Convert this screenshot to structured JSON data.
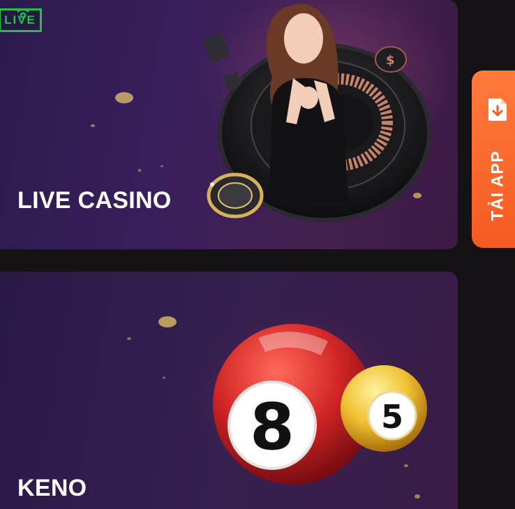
{
  "cards": [
    {
      "id": "live-casino",
      "title": "LIVE CASINO",
      "badge": "LIVE"
    },
    {
      "id": "keno",
      "title": "KENO",
      "ball_numbers": [
        "8",
        "5"
      ]
    }
  ],
  "side_tab": {
    "label": "TẢI APP",
    "icon": "download-icon"
  },
  "colors": {
    "page_bg": "#141214",
    "live_badge": "#22c24a",
    "side_tab": "#f45a21",
    "keno_red_ball": "#d32626",
    "keno_gold_ball": "#f0c030"
  }
}
